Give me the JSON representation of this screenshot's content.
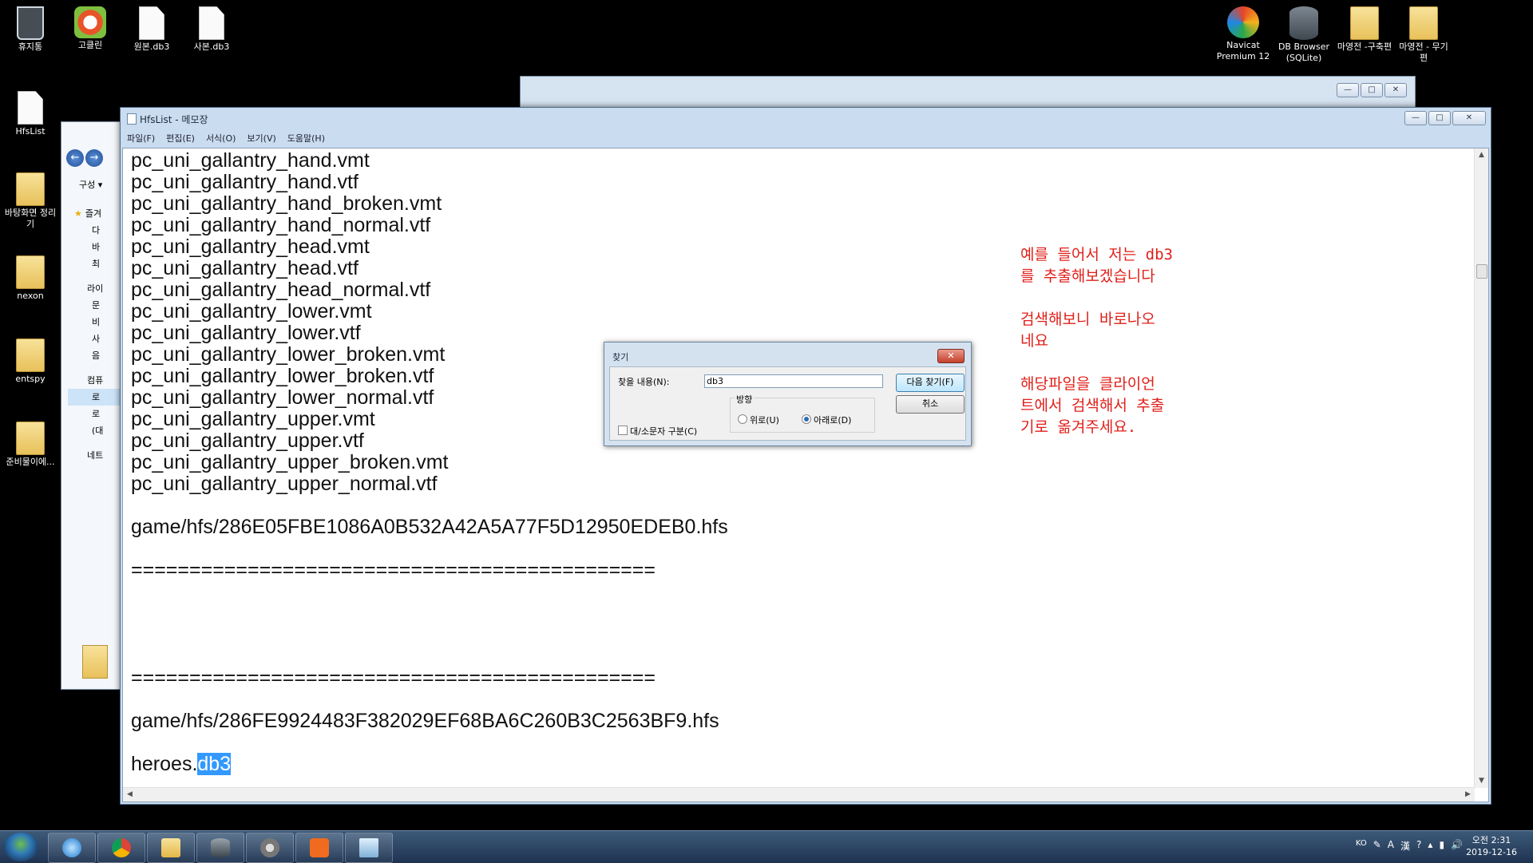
{
  "desktop": {
    "icons_left": [
      {
        "label": "휴지통",
        "icon": "recycle-bin-icon"
      },
      {
        "label": "고클린",
        "icon": "goclean-app-icon"
      },
      {
        "label": "원본.db3",
        "icon": "file-icon"
      },
      {
        "label": "사본.db3",
        "icon": "file-icon"
      },
      {
        "label": "HfsList",
        "icon": "file-icon"
      },
      {
        "label": "바탕화면 정리기",
        "icon": "folder-icon"
      },
      {
        "label": "nexon",
        "icon": "folder-icon"
      },
      {
        "label": "entspy",
        "icon": "folder-icon"
      },
      {
        "label": "준비물이에...",
        "icon": "folder-icon"
      }
    ],
    "icons_right": [
      {
        "label": "Navicat Premium 12",
        "icon": "navicat-app-icon"
      },
      {
        "label": "DB Browser (SQLite)",
        "icon": "database-app-icon"
      },
      {
        "label": "마영전 -구축편",
        "icon": "folder-icon"
      },
      {
        "label": "마영전 - 무기 편",
        "icon": "folder-icon"
      }
    ]
  },
  "explorer_fragment": {
    "organize": "구성 ▾",
    "nav_items": [
      "즐겨",
      "다",
      "바",
      "최",
      "라이",
      "문",
      "비",
      "사",
      "음",
      "컴퓨",
      "로",
      "로",
      "(대",
      "네트"
    ]
  },
  "notepad": {
    "title": "HfsList - 메모장",
    "menu": [
      "파일(F)",
      "편집(E)",
      "서식(O)",
      "보기(V)",
      "도움말(H)"
    ],
    "lines": [
      "pc_uni_gallantry_hand.vmt",
      "pc_uni_gallantry_hand.vtf",
      "pc_uni_gallantry_hand_broken.vmt",
      "pc_uni_gallantry_hand_normal.vtf",
      "pc_uni_gallantry_head.vmt",
      "pc_uni_gallantry_head.vtf",
      "pc_uni_gallantry_head_normal.vtf",
      "pc_uni_gallantry_lower.vmt",
      "pc_uni_gallantry_lower.vtf",
      "pc_uni_gallantry_lower_broken.vmt",
      "pc_uni_gallantry_lower_broken.vtf",
      "pc_uni_gallantry_lower_normal.vtf",
      "pc_uni_gallantry_upper.vmt",
      "pc_uni_gallantry_upper.vtf",
      "pc_uni_gallantry_upper_broken.vmt",
      "pc_uni_gallantry_upper_normal.vtf",
      "",
      "game/hfs/286E05FBE1086A0B532A42A5A77F5D12950EDEB0.hfs",
      "",
      "=============================================",
      "",
      "",
      "",
      "",
      "=============================================",
      "",
      "game/hfs/286FE9924483F382029EF68BA6C260B3C2563BF9.hfs",
      ""
    ],
    "last_line_prefix": "heroes.",
    "last_line_selected": "db3"
  },
  "annotation": "예를 들어서 저는 db3\n를 추출해보겠습니다\n\n검색해보니 바로나오\n네요\n\n해당파일을 클라이언\n트에서 검색해서 추출\n기로 옮겨주세요.",
  "find_dialog": {
    "title": "찾기",
    "find_label": "찾을 내용(N):",
    "find_value": "db3",
    "find_next": "다음 찾기(F)",
    "cancel": "취소",
    "direction_label": "방향",
    "up_label": "위로(U)",
    "down_label": "아래로(D)",
    "direction_selected": "down",
    "match_case_label": "대/소문자 구분(C)",
    "match_case": false
  },
  "taskbar": {
    "apps": [
      "internet-explorer-icon",
      "chrome-icon",
      "file-explorer-icon",
      "database-icon",
      "network-settings-icon",
      "xampp-icon",
      "notepad-icon"
    ],
    "ime": "KO",
    "clock_time": "오전 2:31",
    "clock_date": "2019-12-16"
  },
  "colors": {
    "annotation": "#e0201a",
    "selection": "#3399ff"
  }
}
